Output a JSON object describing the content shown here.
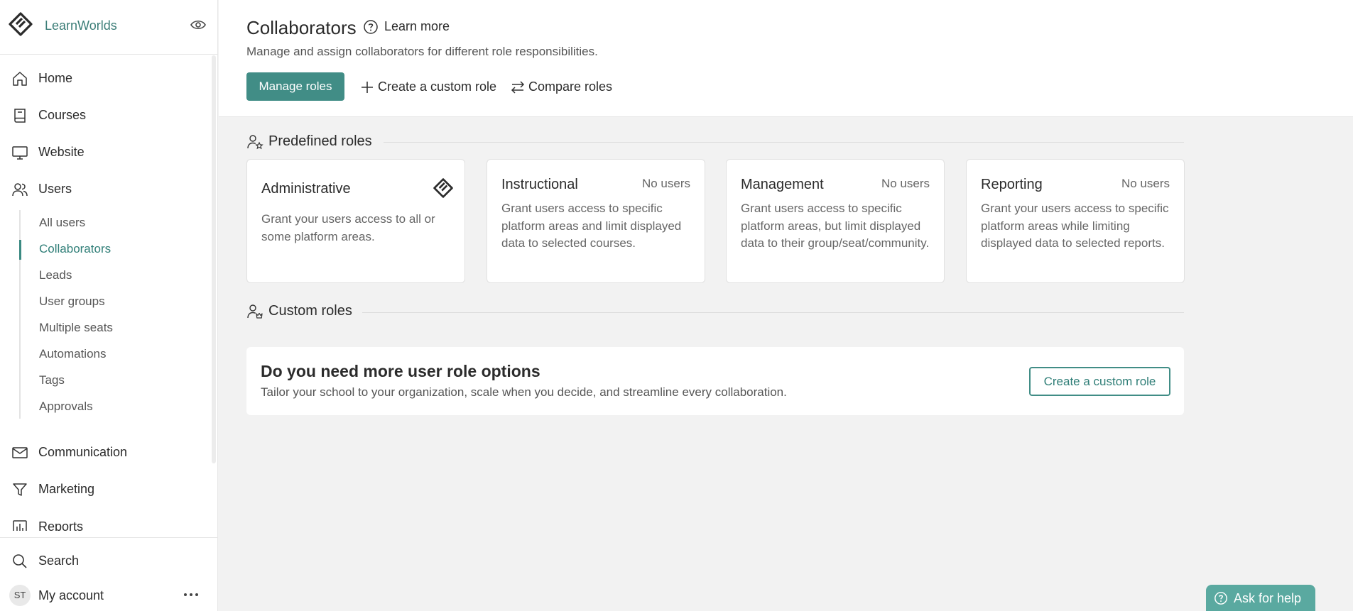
{
  "brand": {
    "name": "LearnWorlds"
  },
  "colors": {
    "accent": "#418d86",
    "accent_text": "#2f7e77",
    "background": "#f2f2f2"
  },
  "sidebar": {
    "items": [
      {
        "label": "Home",
        "icon": "home-icon"
      },
      {
        "label": "Courses",
        "icon": "book-icon"
      },
      {
        "label": "Website",
        "icon": "monitor-icon"
      },
      {
        "label": "Users",
        "icon": "users-icon"
      },
      {
        "label": "Communication",
        "icon": "mail-icon"
      },
      {
        "label": "Marketing",
        "icon": "funnel-icon"
      },
      {
        "label": "Reports",
        "icon": "chart-icon"
      }
    ],
    "users_submenu": [
      {
        "label": "All users"
      },
      {
        "label": "Collaborators",
        "active": true
      },
      {
        "label": "Leads"
      },
      {
        "label": "User groups"
      },
      {
        "label": "Multiple seats"
      },
      {
        "label": "Automations"
      },
      {
        "label": "Tags"
      },
      {
        "label": "Approvals"
      }
    ],
    "search_label": "Search",
    "account_label": "My account",
    "avatar_initials": "ST"
  },
  "header": {
    "title": "Collaborators",
    "learn_more": "Learn more",
    "subtitle": "Manage and assign collaborators for different role responsibilities.",
    "manage_roles": "Manage roles",
    "create_custom_role": "Create a custom role",
    "compare_roles": "Compare roles"
  },
  "predefined": {
    "heading": "Predefined roles",
    "cards": [
      {
        "title": "Administrative",
        "badge": "",
        "desc": "Grant your users access to all or some platform areas."
      },
      {
        "title": "Instructional",
        "badge": "No users",
        "desc": "Grant users access to specific platform areas and limit displayed data to selected courses."
      },
      {
        "title": "Management",
        "badge": "No users",
        "desc": "Grant users access to specific platform areas, but limit displayed data to their group/seat/community."
      },
      {
        "title": "Reporting",
        "badge": "No users",
        "desc": "Grant your users access to specific platform areas while limiting displayed data to selected reports."
      }
    ]
  },
  "custom": {
    "heading": "Custom roles",
    "promo_title": "Do you need more user role options",
    "promo_desc": "Tailor your school to your organization, scale when you decide, and streamline every collaboration.",
    "promo_button": "Create a custom role"
  },
  "help": {
    "label": "Ask for help"
  }
}
